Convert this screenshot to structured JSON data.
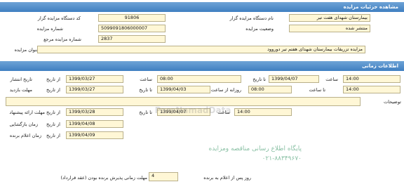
{
  "details": {
    "title": "مشاهده جزئیات مزایده",
    "device_code_label": "کد دستگاه مزایده گزار",
    "device_code_value": "91806",
    "device_name_label": "نام دستگاه مزایده گزار",
    "device_name_value": "بیمارستان شهدای هفت تیر",
    "auction_no_label": "شماره مزایده",
    "auction_no_value": "5099091806000007",
    "status_label": "وضعیت مزایده",
    "status_value": "منتشر شده",
    "ref_no_label": "شماره مزایده مرجع",
    "ref_no_value": "2837",
    "subject_label": "عنوان مزایده",
    "subject_value": "مزایده تزریقات بیمارستان شهدای هفتم تیر دوروود"
  },
  "timing": {
    "title": "اطلاعات زمانی",
    "publish_date_label": "تاریخ انتشار",
    "from_date_label": "از تاریخ",
    "to_date_label": "تا تاریخ",
    "time_label": "ساعت",
    "until_time_label": "تا ساعت",
    "daily_label": "روزانه از ساعت",
    "publish_from_date": "1399/03/27",
    "publish_from_time": "08:00",
    "publish_to_date": "1399/04/07",
    "publish_to_time": "14:00",
    "visit_label": "مهلت بازدید",
    "visit_from_date": "1399/03/27",
    "visit_to_date": "1399/04/03",
    "visit_daily_time": "08:00",
    "visit_until_time": "14:00",
    "notes_label": "توضیحات",
    "notes_value": "",
    "offer_deadline_label": "مهلت ارائه پیشنهاد",
    "offer_from_date": "1399/03/28",
    "offer_to_date": "1399/04/07",
    "offer_to_time": "14:00",
    "opening_label": "زمان بازگشایی",
    "opening_date": "1399/04/08",
    "winner_label": "زمان اعلام برنده",
    "winner_date": "1399/04/09",
    "acceptance_label": "مهلت زمانی پذیرش برنده بودن (عقد قرارداد)",
    "acceptance_value": "4",
    "acceptance_suffix": "روز پس از اعلام به برنده"
  },
  "watermark": {
    "brand": "ParsNamadData",
    "line1": "پایگاه اطلاع رسانی مناقصه ومزایده",
    "line2": "۰۲۱-۸۸۳۴۹۶۷۰"
  }
}
